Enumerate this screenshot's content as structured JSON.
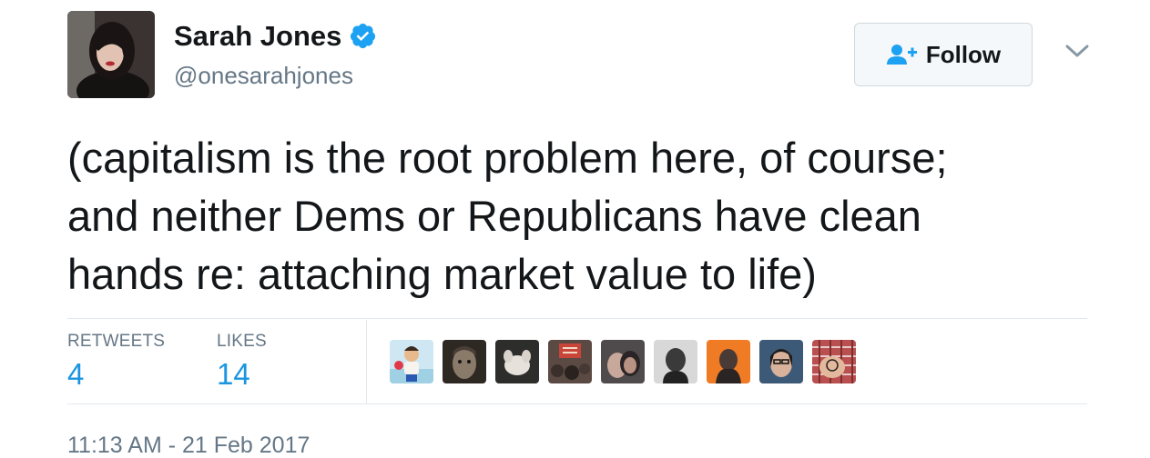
{
  "author": {
    "name": "Sarah Jones",
    "handle": "@onesarahjones",
    "verified": true,
    "avatar_icon": "user-avatar"
  },
  "follow_button": {
    "label": "Follow",
    "icon": "add-user-icon"
  },
  "menu_icon": "chevron-down-icon",
  "tweet": {
    "lines": [
      "(capitalism is the root problem here, of course;",
      "and neither Dems or Republicans have clean",
      "hands re: attaching market value to life)"
    ]
  },
  "stats": {
    "retweets": {
      "label": "RETWEETS",
      "value": "4"
    },
    "likes": {
      "label": "LIKES",
      "value": "14"
    }
  },
  "liker_avatars": [
    {
      "icon": "liker-avatar"
    },
    {
      "icon": "liker-avatar"
    },
    {
      "icon": "liker-avatar"
    },
    {
      "icon": "liker-avatar"
    },
    {
      "icon": "liker-avatar"
    },
    {
      "icon": "liker-avatar"
    },
    {
      "icon": "liker-avatar"
    },
    {
      "icon": "liker-avatar"
    },
    {
      "icon": "liker-avatar"
    }
  ],
  "timestamp": "11:13 AM - 21 Feb 2017",
  "colors": {
    "link_blue": "#1b95e0",
    "verified_blue": "#1da1f2",
    "muted_gray": "#657786"
  }
}
